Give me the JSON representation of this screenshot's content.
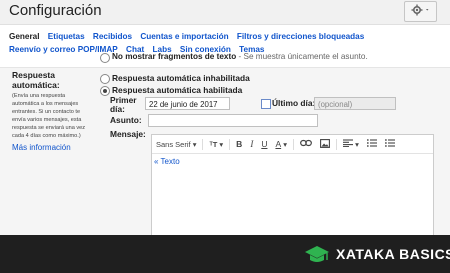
{
  "header": {
    "title": "Configuración"
  },
  "tabs": [
    [
      "General",
      "Etiquetas",
      "Recibidos",
      "Cuentas e importación",
      "Filtros y direcciones bloqueadas"
    ],
    [
      "Reenvío y correo POP/IMAP",
      "Chat",
      "Labs",
      "Sin conexión",
      "Temas"
    ]
  ],
  "snippets": {
    "option_bold": "No mostrar fragmentos de texto",
    "option_rest": " - Se muestra únicamente el asunto."
  },
  "autoreply": {
    "label": "Respuesta automática:",
    "description": "(Envía una respuesta automática a los mensajes entrantes. Si un contacto te envía varios mensajes, esta respuesta se enviará una vez cada 4 días como máximo.)",
    "more_info": "Más información",
    "option_off": "Respuesta automática inhabilitada",
    "option_on": "Respuesta automática habilitada",
    "first_day_label": "Primer día:",
    "first_day_value": "22 de junio de 2017",
    "last_day_label": "Último día:",
    "last_day_placeholder": "(opcional)",
    "subject_label": "Asunto:",
    "message_label": "Mensaje:"
  },
  "editor": {
    "font": "Sans Serif",
    "text_link": "« Texto"
  },
  "footer": {
    "brand": "XATAKA BASICS"
  },
  "colors": {
    "link": "#1155cc",
    "footer_bg": "#1f1f1f",
    "brand_green": "#2fb350"
  }
}
